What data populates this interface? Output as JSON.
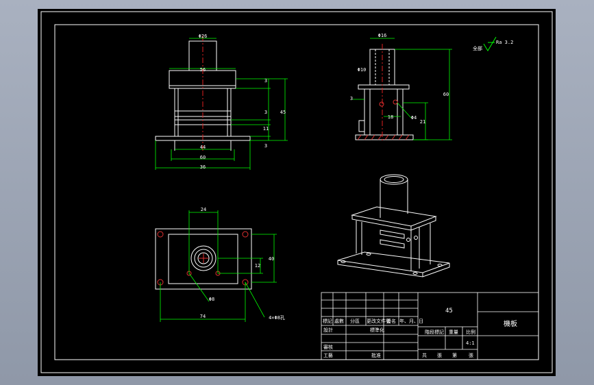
{
  "drawing": {
    "title_cn": "機板",
    "material": "45",
    "scale": "4:1",
    "roughness_note": "全部",
    "roughness_value": "Ra 3.2"
  },
  "dims": {
    "top_d": "Φ26",
    "top_w": "56",
    "h_r1": "3",
    "h_r2": "3",
    "h_r3": "11",
    "h_r4": "3",
    "h_total": "45",
    "b_w1": "44",
    "b_w2": "60",
    "b_w3": "36",
    "s_d1": "Φ16",
    "s_d2": "Φ10",
    "s_l": "3",
    "s_h1": "18",
    "s_h2": "Φ4",
    "s_h3": "21",
    "s_tot": "60",
    "p_w": "24",
    "p_h1": "12",
    "p_h2": "40",
    "p_d": "Φ8",
    "p_w2": "74",
    "p_note": "4×Φ8孔"
  },
  "title_block": {
    "r1": [
      "標記",
      "處數",
      "分區",
      "更改文件號",
      "簽名",
      "年、月、日"
    ],
    "r2a": "設計",
    "r2b": "標準化",
    "r2c": "階段標記",
    "r2d": "重量",
    "r2e": "比例",
    "r3a": "審核",
    "r4a": "工藝",
    "r4b": "批准",
    "r4c": [
      "共",
      "張",
      "第",
      "張"
    ]
  }
}
